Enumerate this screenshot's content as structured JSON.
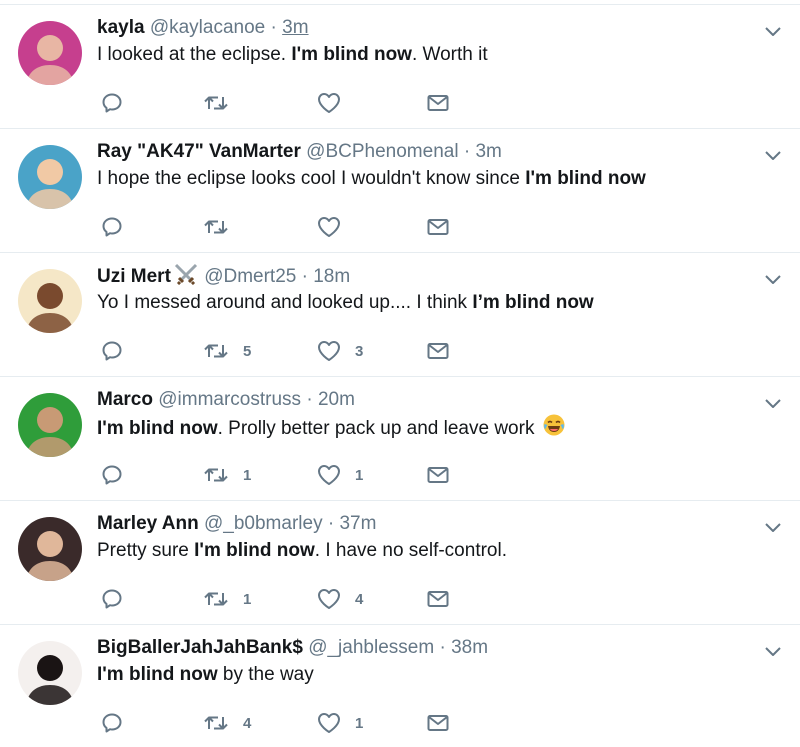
{
  "tweets": [
    {
      "name": "kayla",
      "handle": "@kaylacanoe",
      "sep": "·",
      "time": "3m",
      "text_parts": [
        "I looked at the eclipse. ",
        "I'm blind now",
        ". Worth it"
      ],
      "retweets": "",
      "likes": "",
      "avatar_colors": [
        "#c63f8e",
        "#e8b6a4"
      ]
    },
    {
      "name": "Ray \"AK47\" VanMarter",
      "handle": "@BCPhenomenal",
      "sep": "·",
      "time": "3m",
      "text_parts": [
        "I hope the eclipse looks cool I wouldn't know since ",
        "I'm blind now",
        ""
      ],
      "retweets": "",
      "likes": "",
      "avatar_colors": [
        "#4aa3c8",
        "#f1c9a5"
      ]
    },
    {
      "name": "Uzi Mert",
      "handle": "@Dmert25",
      "sep": "·",
      "time": "18m",
      "text_parts": [
        "Yo I messed around and looked up.... I think ",
        "I’m blind now",
        ""
      ],
      "retweets": "5",
      "likes": "3",
      "avatar_colors": [
        "#f5e7c7",
        "#7a4a2e"
      ]
    },
    {
      "name": "Marco",
      "handle": "@immarcostruss",
      "sep": "·",
      "time": "20m",
      "text_parts": [
        "",
        "I'm blind now",
        ". Prolly better pack up and leave work "
      ],
      "retweets": "1",
      "likes": "1",
      "avatar_colors": [
        "#2f9d3a",
        "#c89a75"
      ]
    },
    {
      "name": "Marley Ann",
      "handle": "@_b0bmarley",
      "sep": "·",
      "time": "37m",
      "text_parts": [
        "Pretty sure ",
        "I'm blind now",
        ". I have no self-control."
      ],
      "retweets": "1",
      "likes": "4",
      "avatar_colors": [
        "#3a2a2a",
        "#e0b79a"
      ]
    },
    {
      "name": "BigBallerJahJahBank$",
      "handle": "@_jahblessem",
      "sep": "·",
      "time": "38m",
      "text_parts": [
        "",
        "I'm blind now",
        " by the way"
      ],
      "retweets": "4",
      "likes": "1",
      "avatar_colors": [
        "#f4f0ee",
        "#1a1414"
      ]
    }
  ],
  "icons": {
    "reply": "reply-icon",
    "retweet": "retweet-icon",
    "like": "heart-icon",
    "dm": "envelope-icon",
    "caret": "chevron-down-icon",
    "swords": "crossed-swords-emoji",
    "laugh": "tears-of-joy-emoji"
  },
  "colors": {
    "icon": "#657786",
    "border": "#e6ecf0",
    "name": "#14171a",
    "meta": "#657786"
  }
}
